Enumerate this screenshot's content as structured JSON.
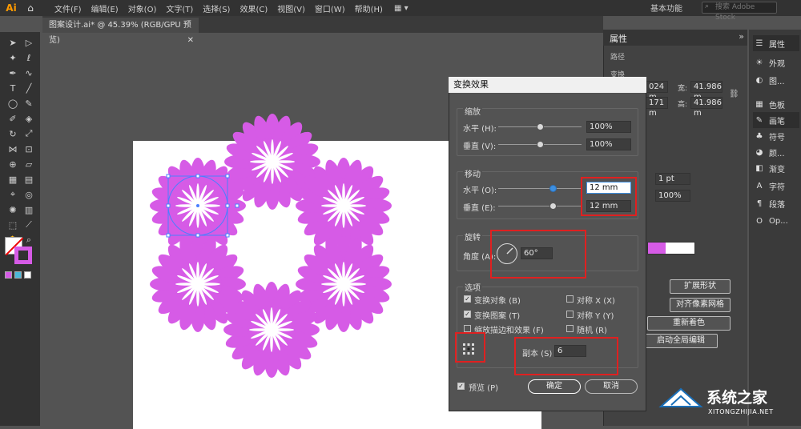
{
  "app": {
    "logo": "Ai"
  },
  "menubar": {
    "items": [
      "文件(F)",
      "编辑(E)",
      "对象(O)",
      "文字(T)",
      "选择(S)",
      "效果(C)",
      "视图(V)",
      "窗口(W)",
      "帮助(H)"
    ],
    "workspace": "基本功能",
    "search_placeholder": "搜索 Adobe Stock"
  },
  "document": {
    "tab_title": "图案设计.ai* @ 45.39% (RGB/GPU 预览)"
  },
  "properties_panel": {
    "title": "属性",
    "section_path": "路径",
    "section_transform": "变换",
    "x_value": "024 m",
    "y_value": "171 m",
    "width_label": "宽:",
    "width_value": "41.986 m",
    "height_label": "高:",
    "height_value": "41.986 m",
    "stroke_value": "1 pt",
    "opacity_value": "100%",
    "btn_expand_shape": "扩展形状",
    "btn_pixel_grid": "对齐像素网格",
    "btn_recolor": "重新着色",
    "btn_global_edit": "启动全局编辑"
  },
  "panel_strip": {
    "items": [
      {
        "label": "属性",
        "icon": "properties-icon"
      },
      {
        "label": "外观",
        "icon": "appearance-icon"
      },
      {
        "label": "图...",
        "icon": "graphic-styles-icon"
      },
      {
        "label": "色板",
        "icon": "swatches-icon"
      },
      {
        "label": "画笔",
        "icon": "brush-icon"
      },
      {
        "label": "符号",
        "icon": "symbols-icon"
      },
      {
        "label": "颜...",
        "icon": "color-icon"
      },
      {
        "label": "渐变",
        "icon": "gradient-icon"
      },
      {
        "label": "字符",
        "icon": "character-icon"
      },
      {
        "label": "段落",
        "icon": "paragraph-icon"
      },
      {
        "label": "Op...",
        "icon": "opentype-icon"
      }
    ]
  },
  "dialog": {
    "title": "变换效果",
    "scale": {
      "label": "缩放",
      "horizontal_label": "水平 (H):",
      "horizontal_value": "100%",
      "vertical_label": "垂直 (V):",
      "vertical_value": "100%"
    },
    "move": {
      "label": "移动",
      "horizontal_label": "水平 (O):",
      "horizontal_value": "12 mm",
      "vertical_label": "垂直 (E):",
      "vertical_value": "12 mm"
    },
    "rotate": {
      "label": "旋转",
      "angle_label": "角度 (A):",
      "angle_value": "60°"
    },
    "options": {
      "label": "选项",
      "transform_objects": "变换对象 (B)",
      "transform_patterns": "变换图案 (T)",
      "scale_strokes": "缩放描边和效果 (F)",
      "reflect_x": "对称 X (X)",
      "reflect_y": "对称 Y (Y)",
      "random": "随机 (R)",
      "transform_objects_checked": true,
      "transform_patterns_checked": true,
      "scale_strokes_checked": false,
      "reflect_x_checked": false,
      "reflect_y_checked": false,
      "random_checked": false
    },
    "copies_label": "副本 (S)",
    "copies_value": "6",
    "preview_label": "预览 (P)",
    "preview_checked": true,
    "ok_label": "确定",
    "cancel_label": "取消"
  },
  "watermark": {
    "title": "系统之家",
    "url": "XITONGZHIJIA.NET"
  },
  "colors": {
    "flower": "#d65be6",
    "highlight_red": "#e02020",
    "move_slider_blue": "#3d8fe0"
  }
}
